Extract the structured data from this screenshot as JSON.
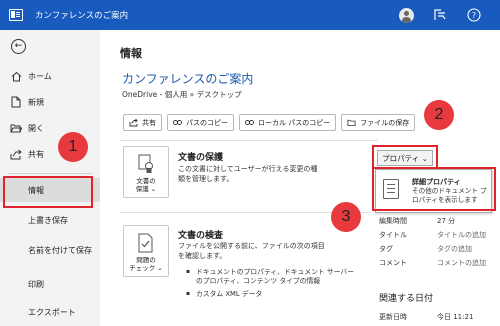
{
  "titlebar": {
    "title": "カンファレンスのご案内",
    "minimize": "—",
    "maximize": "☐",
    "close": "✕"
  },
  "sidebar": {
    "items": [
      {
        "label": "ホーム",
        "icon": "home-icon"
      },
      {
        "label": "新規",
        "icon": "new-doc-icon"
      },
      {
        "label": "開く",
        "icon": "folder-icon"
      },
      {
        "label": "共有",
        "icon": "share-icon"
      },
      {
        "label": "情報"
      },
      {
        "label": "上書き保存"
      },
      {
        "label": "名前を付けて保存"
      },
      {
        "label": "印刷"
      },
      {
        "label": "エクスポート"
      }
    ]
  },
  "main": {
    "heading": "情報",
    "doc_title": "カンファレンスのご案内",
    "doc_path": "OneDrive - 個人用 » デスクトップ",
    "actions": [
      {
        "label": "共有",
        "icon": "share-icon"
      },
      {
        "label": "パスのコピー",
        "icon": "link-icon"
      },
      {
        "label": "ローカル パスのコピー",
        "icon": "link-icon"
      },
      {
        "label": "ファイルの保存",
        "icon": "folder-icon"
      }
    ],
    "protect": {
      "box_label_1": "文書の",
      "box_label_2": "保護 ⌄",
      "title": "文書の保護",
      "desc_1": "この文書に対してユーザーが行える変更の種",
      "desc_2": "類を管理します。"
    },
    "inspect": {
      "box_label_1": "問題の",
      "box_label_2": "チェック ⌄",
      "title": "文書の検査",
      "desc_1": "ファイルを公開する前に、ファイルの次の項目",
      "desc_2": "を確認します。",
      "bullets": [
        "ドキュメントのプロパティ、ドキュメント サーバーのプロパティ、コンテンツ タイプの情報",
        "カスタム XML データ"
      ]
    },
    "properties": {
      "button_label": "プロパティ ⌄",
      "menu_title": "詳細プロパティ",
      "menu_desc": "その他のドキュメント プロパティを表示します",
      "rows": [
        {
          "key": "編集時間",
          "value": "27 分"
        },
        {
          "key": "タイトル",
          "value": "タイトルの追加"
        },
        {
          "key": "タグ",
          "value": "タグの追加"
        },
        {
          "key": "コメント",
          "value": "コメントの追加"
        }
      ],
      "related_heading": "関連する日付",
      "last_updated_key": "更新日時",
      "last_updated_value": "今日 11:21"
    }
  },
  "callouts": [
    "1",
    "2",
    "3"
  ],
  "colors": {
    "titlebar": "#185abd",
    "accent": "#1a5aad",
    "highlight": "#e0242d",
    "callout": "#e83a3e"
  }
}
